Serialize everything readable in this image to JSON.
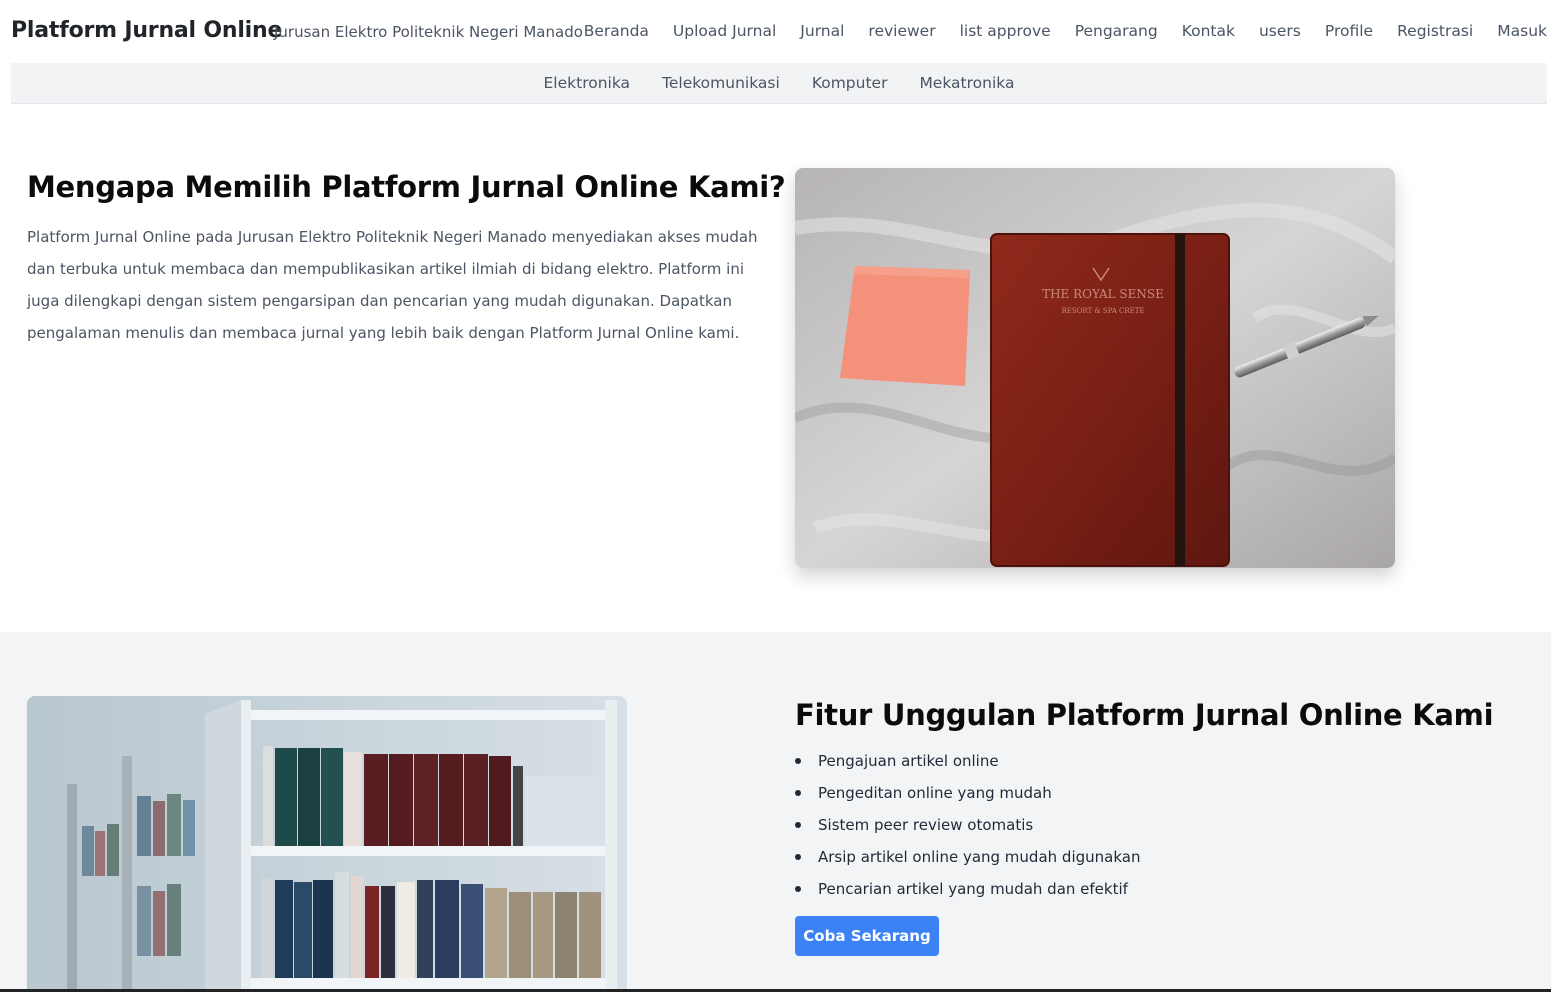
{
  "header": {
    "brand": "Platform Jurnal Online",
    "tagline": "Jurusan Elektro Politeknik Negeri Manado",
    "nav": [
      "Beranda",
      "Upload Jurnal",
      "Jurnal",
      "reviewer",
      "list approve",
      "Pengarang",
      "Kontak",
      "users",
      "Profile",
      "Registrasi",
      "Masuk"
    ]
  },
  "subnav": [
    "Elektronika",
    "Telekomunikasi",
    "Komputer",
    "Mekatronika"
  ],
  "why": {
    "title": "Mengapa Memilih Platform Jurnal Online Kami?",
    "text": "Platform Jurnal Online pada Jurusan Elektro Politeknik Negeri Manado menyediakan akses mudah dan terbuka untuk membaca dan mempublikasikan artikel ilmiah di bidang elektro. Platform ini juga dilengkapi dengan sistem pengarsipan dan pencarian yang mudah digunakan. Dapatkan pengalaman menulis dan membaca jurnal yang lebih baik dengan Platform Jurnal Online kami.",
    "image_icon": "notebook-photo",
    "notebook_imprint": "THE ROYAL SENSE",
    "notebook_subimprint": "RESORT & SPA CRETE"
  },
  "features": {
    "title": "Fitur Unggulan Platform Jurnal Online Kami",
    "items": [
      "Pengajuan artikel online",
      "Pengeditan online yang mudah",
      "Sistem peer review otomatis",
      "Arsip artikel online yang mudah digunakan",
      "Pencarian artikel yang mudah dan efektif"
    ],
    "cta": "Coba Sekarang",
    "image_icon": "library-bookshelf-photo"
  },
  "colors": {
    "accent": "#3b82f6",
    "band_bg": "#f3f4f6",
    "subnav_bg": "#f2f3f4"
  }
}
